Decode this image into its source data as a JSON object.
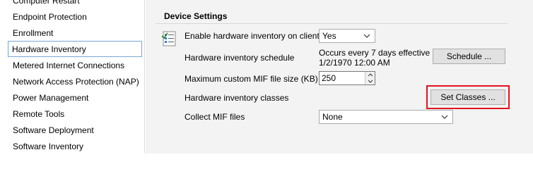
{
  "sidebar": {
    "items": [
      {
        "label": "Computer Restart",
        "selected": false
      },
      {
        "label": "Endpoint Protection",
        "selected": false
      },
      {
        "label": "Enrollment",
        "selected": false
      },
      {
        "label": "Hardware Inventory",
        "selected": true
      },
      {
        "label": "Metered Internet Connections",
        "selected": false
      },
      {
        "label": "Network Access Protection (NAP)",
        "selected": false
      },
      {
        "label": "Power Management",
        "selected": false
      },
      {
        "label": "Remote Tools",
        "selected": false
      },
      {
        "label": "Software Deployment",
        "selected": false
      },
      {
        "label": "Software Inventory",
        "selected": false
      }
    ]
  },
  "main": {
    "section_title": "Device Settings",
    "enable": {
      "label": "Enable hardware inventory on clients",
      "value": "Yes"
    },
    "schedule": {
      "label": "Hardware inventory schedule",
      "line1": "Occurs every 7 days effective",
      "line2": "1/2/1970 12:00 AM",
      "button": "Schedule ..."
    },
    "mif_size": {
      "label": "Maximum custom MIF file size (KB)",
      "value": "250"
    },
    "classes": {
      "label": "Hardware inventory classes",
      "button": "Set Classes ..."
    },
    "collect_mif": {
      "label": "Collect MIF files",
      "value": "None"
    }
  },
  "colors": {
    "highlight": "#e0141e",
    "selection_border": "#7aa7d6",
    "pane_background": "#f3f3f3"
  },
  "icons": [
    "settings-list-icon",
    "chevron-down-icon",
    "spin-up-icon",
    "spin-down-icon"
  ]
}
